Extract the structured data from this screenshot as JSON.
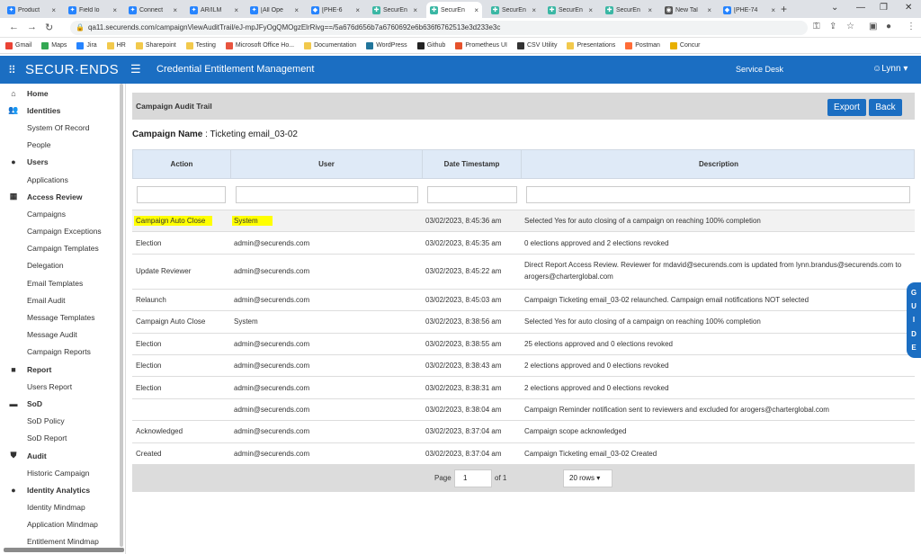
{
  "browser": {
    "tabs": [
      {
        "label": "Product",
        "icon": "confluence-icon",
        "active": false
      },
      {
        "label": "Field lo",
        "icon": "confluence-icon",
        "active": false
      },
      {
        "label": "Connect",
        "icon": "confluence-icon",
        "active": false
      },
      {
        "label": "AR/ILM",
        "icon": "confluence-icon",
        "active": false
      },
      {
        "label": "[All Ope",
        "icon": "confluence-icon",
        "active": false
      },
      {
        "label": "[PHE-6",
        "icon": "jira-icon",
        "active": false
      },
      {
        "label": "SecurEn",
        "icon": "securends-icon",
        "active": false
      },
      {
        "label": "SecurEn",
        "icon": "securends-icon",
        "active": true
      },
      {
        "label": "SecurEn",
        "icon": "securends-icon",
        "active": false
      },
      {
        "label": "SecurEn",
        "icon": "securends-icon",
        "active": false
      },
      {
        "label": "SecurEn",
        "icon": "securends-icon",
        "active": false
      },
      {
        "label": "New Tal",
        "icon": "globe-icon",
        "active": false
      },
      {
        "label": "[PHE-74",
        "icon": "jira-icon",
        "active": false
      }
    ],
    "url": "qa11.securends.com/campaignViewAuditTrail/eJ-mpJFyOgQMOgzElrRivg==/5a676d656b7a6760692e6b636f6762513e3d233e3c",
    "bookmarks": [
      "Gmail",
      "Maps",
      "Jira",
      "HR",
      "Sharepoint",
      "Testing",
      "Microsoft Office Ho...",
      "Documentation",
      "WordPress",
      "Github",
      "Prometheus UI",
      "CSV Utility",
      "Presentations",
      "Postman",
      "Concur"
    ]
  },
  "header": {
    "logo": "SECUR·ENDS",
    "title": "Credential Entitlement Management",
    "service_desk": "Service Desk",
    "user": "Lynn"
  },
  "sidebar": {
    "items": [
      {
        "label": "Home",
        "type": "section",
        "icon": "home-icon",
        "glyph": "⌂"
      },
      {
        "label": "Identities",
        "type": "section",
        "icon": "people-icon",
        "glyph": "👥"
      },
      {
        "label": "System Of Record",
        "type": "sub"
      },
      {
        "label": "People",
        "type": "sub"
      },
      {
        "label": "Users",
        "type": "section",
        "icon": "user-icon",
        "glyph": "●"
      },
      {
        "label": "Applications",
        "type": "sub"
      },
      {
        "label": "Access Review",
        "type": "section",
        "icon": "grid-icon",
        "glyph": "▦"
      },
      {
        "label": "Campaigns",
        "type": "sub"
      },
      {
        "label": "Campaign Exceptions",
        "type": "sub"
      },
      {
        "label": "Campaign Templates",
        "type": "sub"
      },
      {
        "label": "Delegation",
        "type": "sub"
      },
      {
        "label": "Email Templates",
        "type": "sub"
      },
      {
        "label": "Email Audit",
        "type": "sub"
      },
      {
        "label": "Message Templates",
        "type": "sub"
      },
      {
        "label": "Message Audit",
        "type": "sub"
      },
      {
        "label": "Campaign Reports",
        "type": "sub"
      },
      {
        "label": "Report",
        "type": "section",
        "icon": "report-icon",
        "glyph": "■"
      },
      {
        "label": "Users Report",
        "type": "sub"
      },
      {
        "label": "SoD",
        "type": "section",
        "icon": "sod-icon",
        "glyph": "▬"
      },
      {
        "label": "SoD Policy",
        "type": "sub"
      },
      {
        "label": "SoD Report",
        "type": "sub"
      },
      {
        "label": "Audit",
        "type": "section",
        "icon": "shield-icon",
        "glyph": "⛊"
      },
      {
        "label": "Historic Campaign",
        "type": "sub"
      },
      {
        "label": "Identity Analytics",
        "type": "section",
        "icon": "analytics-icon",
        "glyph": "●"
      },
      {
        "label": "Identity Mindmap",
        "type": "sub"
      },
      {
        "label": "Application Mindmap",
        "type": "sub"
      },
      {
        "label": "Entitlement Mindmap",
        "type": "sub"
      }
    ]
  },
  "panel": {
    "title": "Campaign Audit Trail",
    "export_label": "Export",
    "back_label": "Back",
    "campaign_name_label": "Campaign Name",
    "campaign_name_value": ": Ticketing email_03-02"
  },
  "table": {
    "columns": [
      "Action",
      "User",
      "Date Timestamp",
      "Description"
    ],
    "rows": [
      {
        "action": "Campaign Auto Close",
        "user": "System",
        "ts": "03/02/2023, 8:45:36 am",
        "desc": "Selected Yes for auto closing of a campaign on reaching 100% completion",
        "highlight": true
      },
      {
        "action": "Election",
        "user": "admin@securends.com",
        "ts": "03/02/2023, 8:45:35 am",
        "desc": "0 elections approved and 2 elections revoked"
      },
      {
        "action": "Update Reviewer",
        "user": "admin@securends.com",
        "ts": "03/02/2023, 8:45:22 am",
        "desc": "Direct Report Access Review. Reviewer for mdavid@securends.com is updated from lynn.brandus@securends.com to arogers@charterglobal.com",
        "tall": true
      },
      {
        "action": "Relaunch",
        "user": "admin@securends.com",
        "ts": "03/02/2023, 8:45:03 am",
        "desc": "Campaign Ticketing email_03-02 relaunched. Campaign email notifications NOT selected"
      },
      {
        "action": "Campaign Auto Close",
        "user": "System",
        "ts": "03/02/2023, 8:38:56 am",
        "desc": "Selected Yes for auto closing of a campaign on reaching 100% completion"
      },
      {
        "action": "Election",
        "user": "admin@securends.com",
        "ts": "03/02/2023, 8:38:55 am",
        "desc": "25 elections approved and 0 elections revoked"
      },
      {
        "action": "Election",
        "user": "admin@securends.com",
        "ts": "03/02/2023, 8:38:43 am",
        "desc": "2 elections approved and 0 elections revoked"
      },
      {
        "action": "Election",
        "user": "admin@securends.com",
        "ts": "03/02/2023, 8:38:31 am",
        "desc": "2 elections approved and 0 elections revoked"
      },
      {
        "action": "",
        "user": "admin@securends.com",
        "ts": "03/02/2023, 8:38:04 am",
        "desc": "Campaign Reminder notification sent to reviewers and excluded for arogers@charterglobal.com"
      },
      {
        "action": "Acknowledged",
        "user": "admin@securends.com",
        "ts": "03/02/2023, 8:37:04 am",
        "desc": "Campaign scope acknowledged"
      },
      {
        "action": "Created",
        "user": "admin@securends.com",
        "ts": "03/02/2023, 8:37:04 am",
        "desc": "Campaign Ticketing email_03-02 Created"
      }
    ]
  },
  "pager": {
    "page_label": "Page",
    "page_value": "1",
    "of_label": "of 1",
    "rows_option": "20 rows"
  },
  "guide": {
    "letters": [
      "G",
      "U",
      "I",
      "D",
      "E"
    ]
  },
  "colors": {
    "brand": "#1b6ec2",
    "highlight": "#ffff00",
    "table_header": "#dfeaf7"
  }
}
